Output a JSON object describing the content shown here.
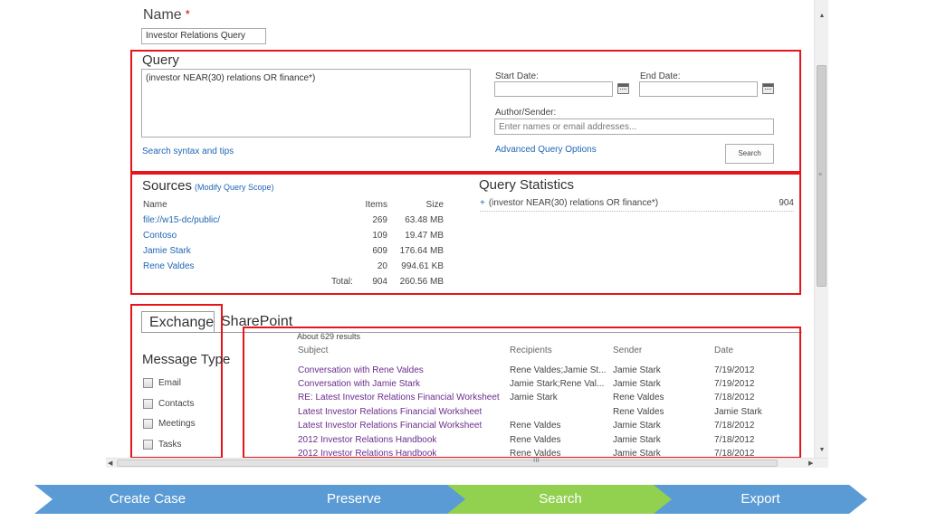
{
  "form": {
    "name_label": "Name",
    "required_mark": "*",
    "name_value": "Investor Relations Query"
  },
  "query": {
    "heading": "Query",
    "text": "(investor NEAR(30) relations OR finance*)",
    "syntax_link": "Search syntax and tips",
    "start_date_label": "Start Date:",
    "end_date_label": "End Date:",
    "start_date_value": "",
    "end_date_value": "",
    "author_label": "Author/Sender:",
    "author_placeholder": "Enter names or email addresses...",
    "advanced_link": "Advanced Query Options",
    "search_button": "Search"
  },
  "sources": {
    "heading": "Sources",
    "modify_link": "(Modify Query Scope)",
    "columns": {
      "name": "Name",
      "items": "Items",
      "size": "Size"
    },
    "rows": [
      {
        "name": "file://w15-dc/public/",
        "items": "269",
        "size": "63.48 MB"
      },
      {
        "name": "Contoso",
        "items": "109",
        "size": "19.47 MB"
      },
      {
        "name": "Jamie Stark",
        "items": "609",
        "size": "176.64 MB"
      },
      {
        "name": "Rene Valdes",
        "items": "20",
        "size": "994.61 KB"
      }
    ],
    "total_label": "Total:",
    "total_items": "904",
    "total_size": "260.56 MB"
  },
  "query_stats": {
    "heading": "Query Statistics",
    "expand": "+",
    "row_query": "(investor NEAR(30) relations OR finance*)",
    "row_value": "904"
  },
  "tabs": {
    "exchange": "Exchange",
    "sharepoint": "SharePoint"
  },
  "message_type": {
    "heading": "Message Type",
    "options": [
      "Email",
      "Contacts",
      "Meetings",
      "Tasks"
    ]
  },
  "results": {
    "count": "About 629 results",
    "columns": {
      "subject": "Subject",
      "recipients": "Recipients",
      "sender": "Sender",
      "date": "Date"
    },
    "rows": [
      {
        "subject": "Conversation with Rene Valdes",
        "recipients": "Rene Valdes;Jamie St...",
        "sender": "Jamie Stark",
        "date": "7/19/2012"
      },
      {
        "subject": "Conversation with Jamie Stark",
        "recipients": "Jamie Stark;Rene Val...",
        "sender": "Jamie Stark",
        "date": "7/19/2012"
      },
      {
        "subject": "RE: Latest Investor Relations Financial Worksheet",
        "recipients": "Jamie Stark",
        "sender": "Rene Valdes",
        "date": "7/18/2012"
      },
      {
        "subject": "Latest Investor Relations Financial Worksheet",
        "recipients": "",
        "sender": "Rene Valdes",
        "date": "Jamie Stark"
      },
      {
        "subject": "Latest Investor Relations Financial Worksheet",
        "recipients": "Rene Valdes",
        "sender": "Jamie Stark",
        "date": "7/18/2012"
      },
      {
        "subject": "2012 Investor Relations Handbook",
        "recipients": "Rene Valdes",
        "sender": "Jamie Stark",
        "date": "7/18/2012"
      },
      {
        "subject": "2012 Investor Relations Handbook",
        "recipients": "Rene Valdes",
        "sender": "Jamie Stark",
        "date": "7/18/2012"
      }
    ]
  },
  "scrollbar": {
    "grip": "≡",
    "hgrip": "III"
  },
  "process_steps": [
    {
      "label": "Create Case",
      "color": "#5b9bd5"
    },
    {
      "label": "Preserve",
      "color": "#5b9bd5"
    },
    {
      "label": "Search",
      "color": "#92d050"
    },
    {
      "label": "Export",
      "color": "#5b9bd5"
    }
  ]
}
